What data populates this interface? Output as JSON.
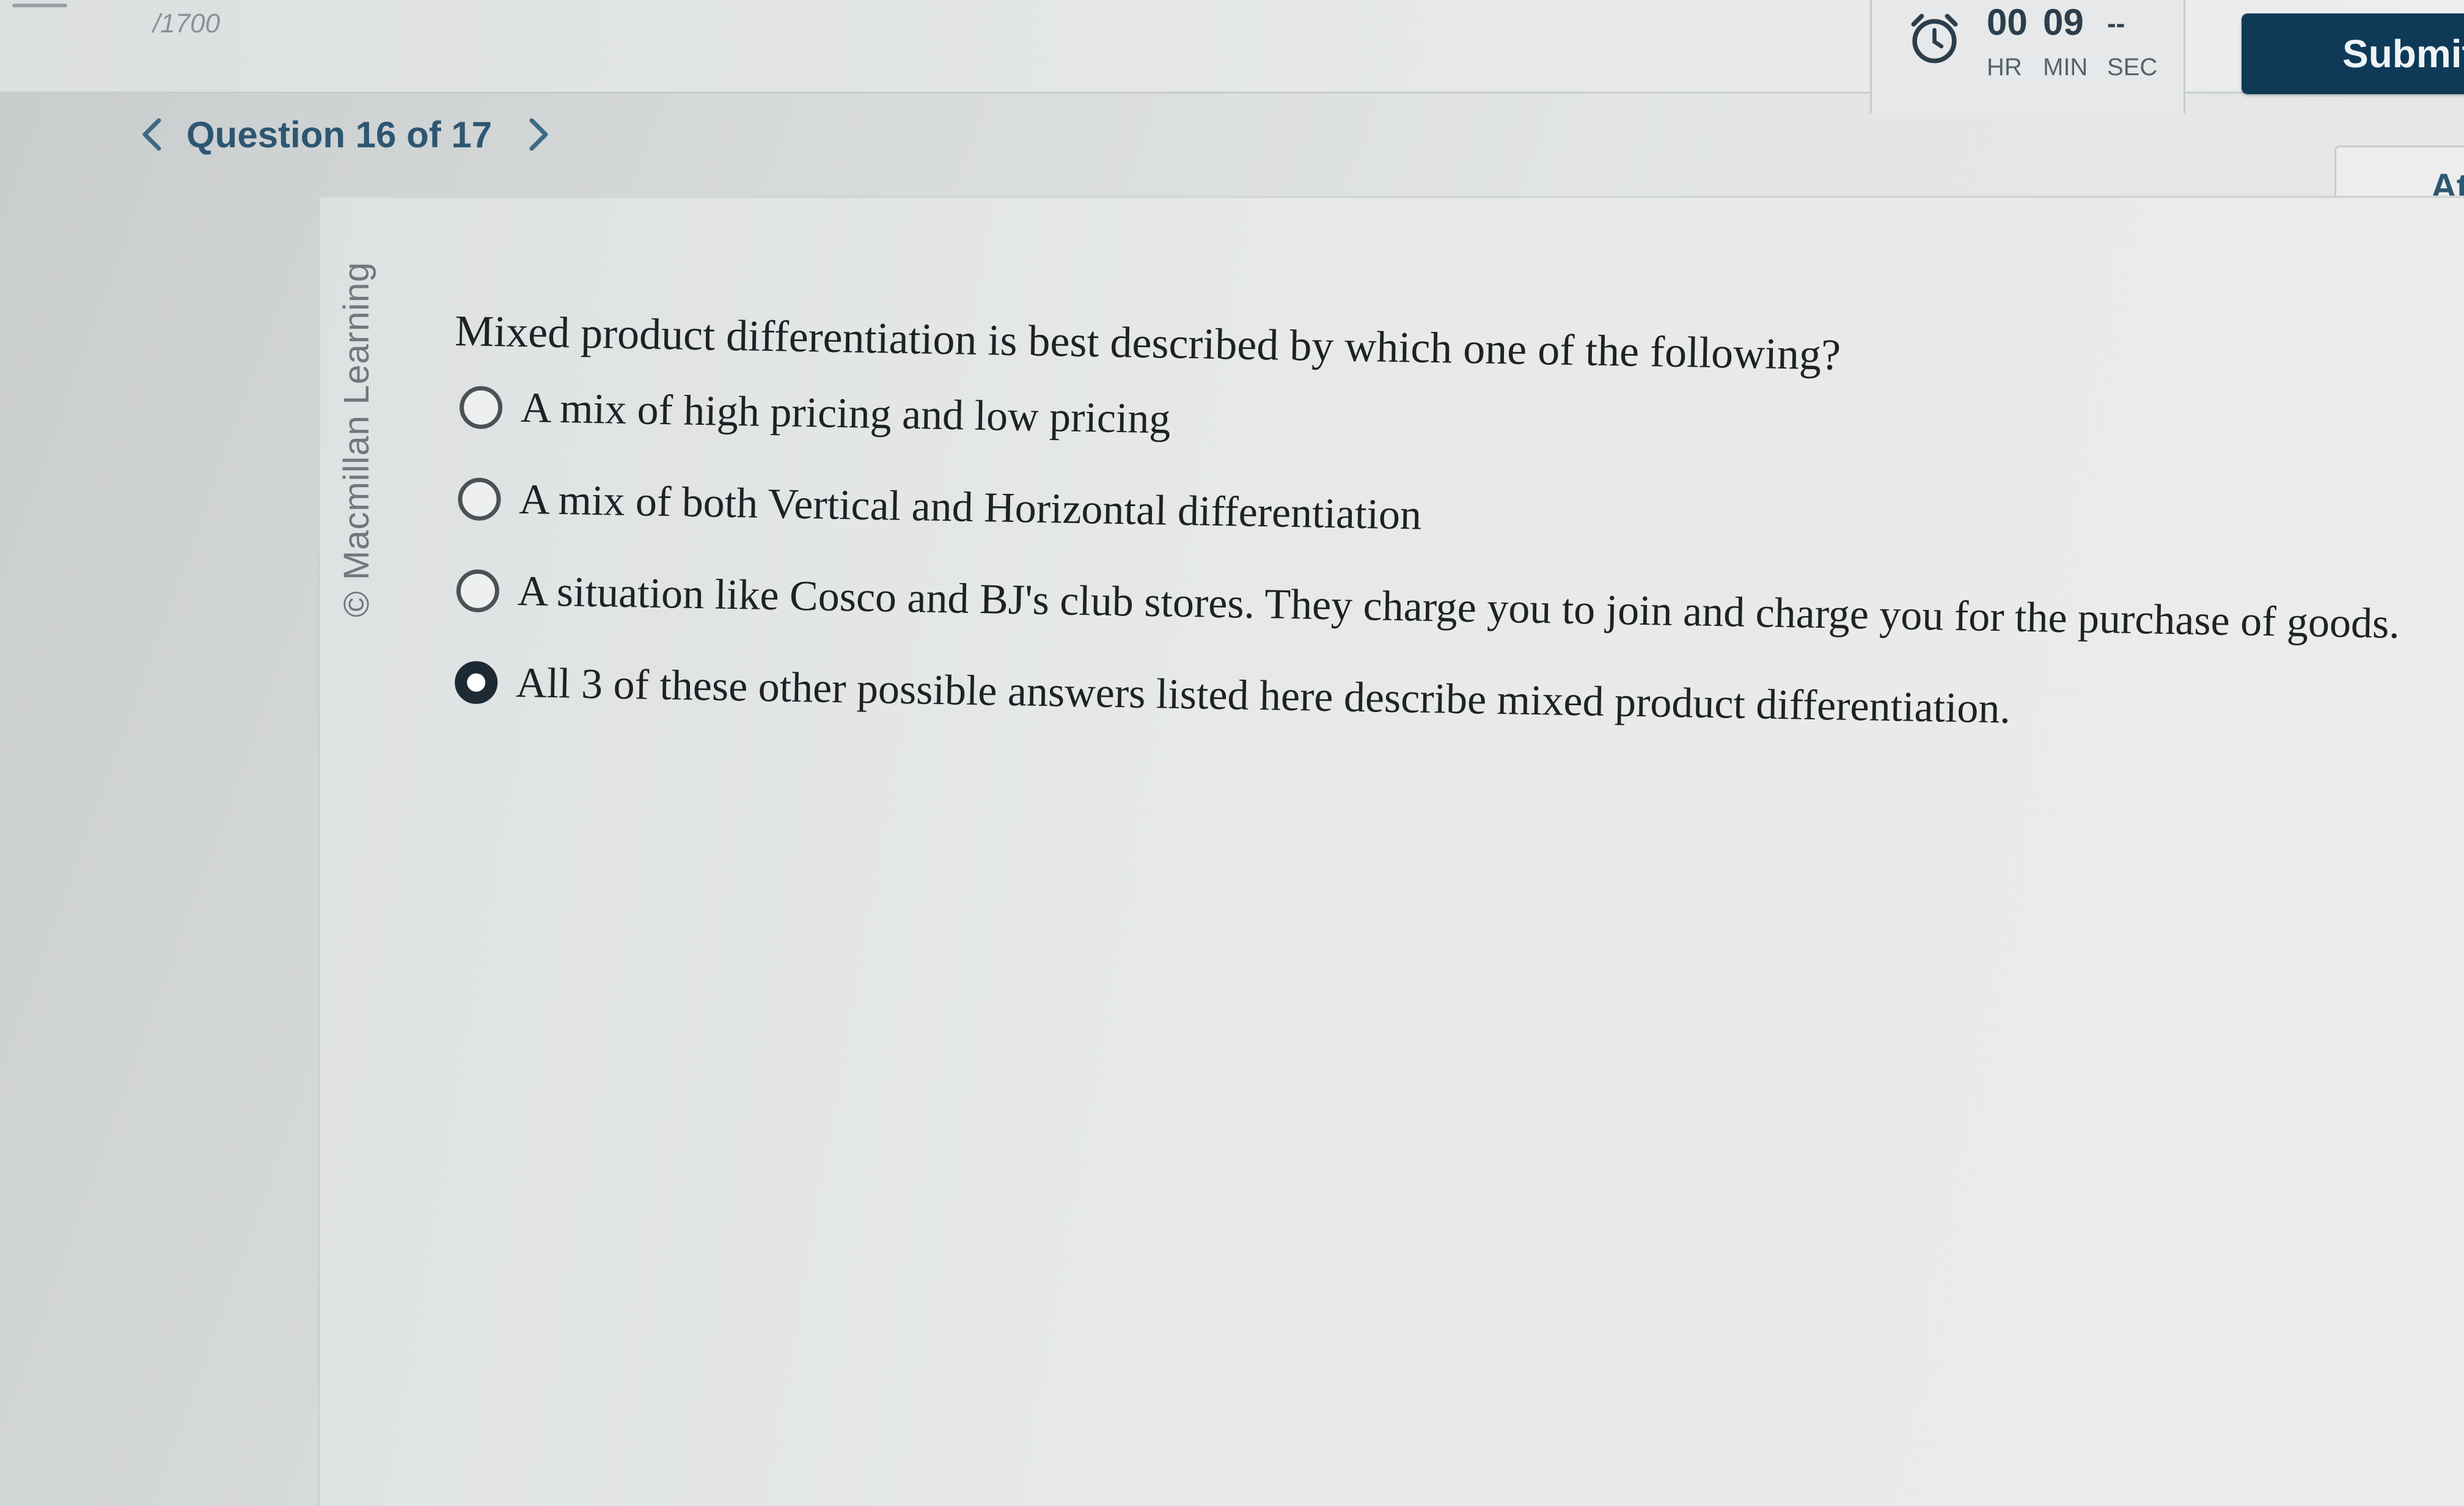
{
  "header": {
    "score": "/1700",
    "timer": {
      "hours_value": "00",
      "minutes_value": "09",
      "seconds_value": "--",
      "hours_label": "HR",
      "minutes_label": "MIN",
      "seconds_label": "SEC"
    },
    "submit_label": "Submit",
    "attempt_label": "At"
  },
  "navigation": {
    "prev_icon": "chevron-left-icon",
    "next_icon": "chevron-right-icon",
    "title": "Question 16 of 17"
  },
  "question": {
    "watermark": "© Macmillan Learning",
    "text": "Mixed product differentiation is best described by which one of the following?",
    "options": [
      {
        "label": "A mix of high pricing and low pricing",
        "selected": false
      },
      {
        "label": "A mix of both Vertical and Horizontal differentiation",
        "selected": false
      },
      {
        "label": "A situation like Cosco and BJ's club stores. They charge you to join and charge you for the purchase of goods.",
        "selected": false
      },
      {
        "label": "All 3 of these other possible answers listed here describe mixed product differentiation.",
        "selected": true
      }
    ]
  },
  "colors": {
    "submit_background": "#0e3a58",
    "nav_text": "#2d5672",
    "selected_radio": "#1d2a33"
  }
}
